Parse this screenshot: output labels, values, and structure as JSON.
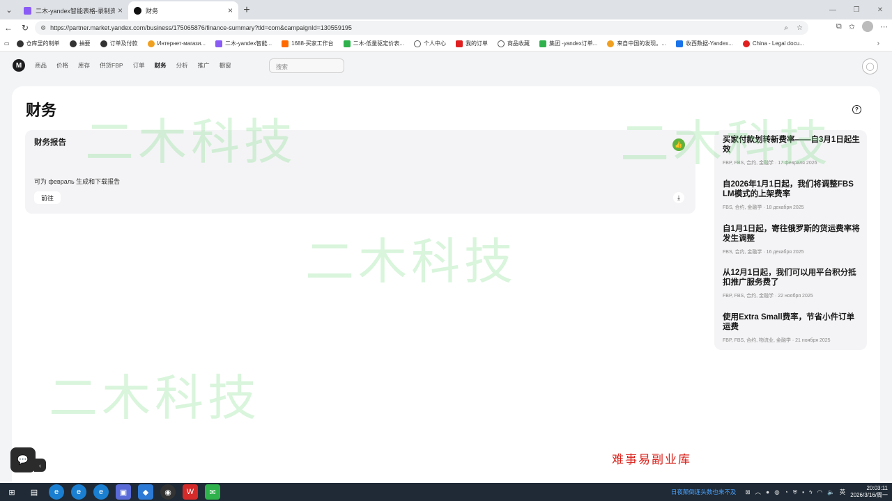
{
  "browser": {
    "tabs": [
      {
        "title": "二木-yandex智能表格-录制资料 -",
        "active": false,
        "color": "#8a5cf5"
      },
      {
        "title": "财务",
        "active": true,
        "color": "#111111"
      }
    ],
    "url": "https://partner.market.yandex.com/business/175065876/finance-summary?tld=com&campaignId=130559195",
    "bookmarks": [
      {
        "label": "仓库里的制单",
        "color": "#333333"
      },
      {
        "label": "抽要",
        "color": "#333333"
      },
      {
        "label": "订单及付款",
        "color": "#333333"
      },
      {
        "label": "Интернет-магази...",
        "color": "#f0a020"
      },
      {
        "label": "二木-yandex智能...",
        "color": "#8a5cf5"
      },
      {
        "label": "1688-买家工作台",
        "color": "#ff6a00"
      },
      {
        "label": "二木-低量驱定价表...",
        "color": "#2fb24c"
      },
      {
        "label": "个人中心",
        "color": "#555555"
      },
      {
        "label": "我的订单",
        "color": "#e02020"
      },
      {
        "label": "商品收藏",
        "color": "#555555"
      },
      {
        "label": "集团 -yandex订单...",
        "color": "#2fb24c"
      },
      {
        "label": "来自中国的发现。...",
        "color": "#f0a020"
      },
      {
        "label": "收西数据-Yandex...",
        "color": "#1a73e8"
      },
      {
        "label": "China - Legal docu...",
        "color": "#e02020"
      }
    ]
  },
  "nav": {
    "logo": "M",
    "items": [
      "商品",
      "价格",
      "库存",
      "供货FBP",
      "订单",
      "财务",
      "分析",
      "推广",
      "橱窗"
    ],
    "active": "财务",
    "search_placeholder": "搜索"
  },
  "page": {
    "title": "财务",
    "report": {
      "title": "财务报告",
      "description": "可为 февраль 生成和下载报告",
      "goto_label": "前往"
    },
    "news": [
      {
        "title": "买家付款划转新费率——自3月1日起生效",
        "meta": "FBP, FBS, 合约, 金融学 · 17 февраля 2026"
      },
      {
        "title": "自2026年1月1日起，我们将调整FBS LM模式的上架费率",
        "meta": "FBS, 合约, 金融学 · 18 декабря 2025"
      },
      {
        "title": "自1月1日起，寄往俄罗斯的货运费率将发生调整",
        "meta": "FBS, 合约, 金融学 · 16 декабря 2025"
      },
      {
        "title": "从12月1日起，我们可以用平台积分抵扣推广服务费了",
        "meta": "FBP, FBS, 合约, 金融学 · 22 ноября 2025"
      },
      {
        "title": "使用Extra Small费率，节省小件订单运费",
        "meta": "FBP, FBS, 合约, 物流业, 金融学 · 21 ноября 2025"
      }
    ]
  },
  "watermarks": {
    "text": "二木科技",
    "corner_text": "难事易副业库"
  },
  "taskbar": {
    "notice": "日夜颠倒连头数也来不及",
    "ime": "英",
    "time": "20:03:11",
    "date": "2026/3/16/周一"
  }
}
